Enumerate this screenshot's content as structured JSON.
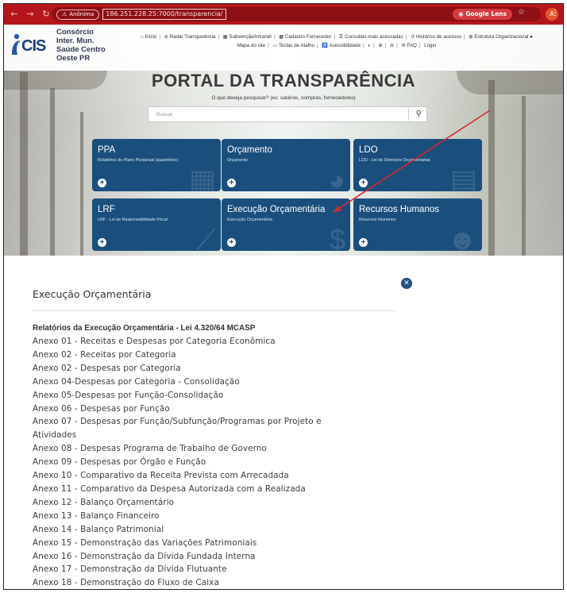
{
  "browser": {
    "incognito_label": "Anônima",
    "url": "186.251.228.25:7000/transparencia/",
    "lens_label": "Google Lens",
    "profile_initial": "A"
  },
  "site": {
    "logo": {
      "mark": "CIS",
      "name_lines": [
        "Consórcio",
        "Inter. Mun.",
        "Saúde Centro",
        "Oeste PR"
      ]
    },
    "menu_row1": [
      "Início",
      "Radar Transparência",
      "Subvenção/Intranet",
      "Cadastro Fornecedor",
      "Consultas mais acessadas",
      "Histórico de acessos",
      "Estrutura Organizacional"
    ],
    "menu_row2": [
      "Mapa do site",
      "Teclas de Atalho",
      "Acessibilidade",
      "FAQ",
      "Login"
    ],
    "title": "PORTAL DA TRANSPARÊNCIA",
    "search_question": "O que deseja pesquisar? (ex: salários, compras, fornecedores)",
    "search_placeholder": "Buscar",
    "cards": [
      {
        "title": "PPA",
        "subtitle": "Relatórios do Plano Plurianual (quadriênio)"
      },
      {
        "title": "Orçamento",
        "subtitle": "Orçamento"
      },
      {
        "title": "LDO",
        "subtitle": "LDO - Lei de Diretrizes Orçamentárias"
      },
      {
        "title": "LRF",
        "subtitle": "LRF - Lei de Responsabilidade Fiscal"
      },
      {
        "title": "Execução Orçamentária",
        "subtitle": "Execução Orçamentária"
      },
      {
        "title": "Recursos Humanos",
        "subtitle": "Recursos Humanos"
      }
    ]
  },
  "modal": {
    "title": "Execução Orçamentária",
    "section_heading": "Relatórios da Execução Orçamentária - Lei 4.320/64 MCASP",
    "annexes": [
      "Anexo 01 - Receitas e Despesas por Categoria Econômica",
      "Anexo 02 - Receitas por Categoria",
      "Anexo 02 - Despesas por Categoria",
      "Anexo 04-Despesas por Categoria - Consolidação",
      "Anexo 05-Despesas por Função-Consolidação",
      "Anexo 06 - Despesas por Função",
      "Anexo 07 - Despesas por Função/Subfunção/Programas por Projeto e",
      "Atividades",
      "Anexo 08 - Despesas Programa de Trabalho de Governo",
      "Anexo 09 - Despesas por Órgão e Função",
      "Anexo 10 - Comparativo da Receita Prevista com Arrecadada",
      "Anexo 11 - Comparativo da Despesa Autorizada com a Realizada",
      "Anexo 12 - Balanço Orçamentário",
      "Anexo 13 - Balanço Financeiro",
      "Anexo 14 - Balanço Patrimonial",
      "Anexo 15 - Demonstração das Variações Patrimoniais",
      "Anexo 16 - Demonstração da Dívida Fundada Interna",
      "Anexo 17 - Demonstração da Dívida Flutuante",
      "Anexo 18 - Demonstração do Fluxo de Caixa"
    ]
  },
  "colors": {
    "browser_bar": "#b5161c",
    "card_blue": "#1a4f7d",
    "arrow_red": "#d9262c"
  }
}
